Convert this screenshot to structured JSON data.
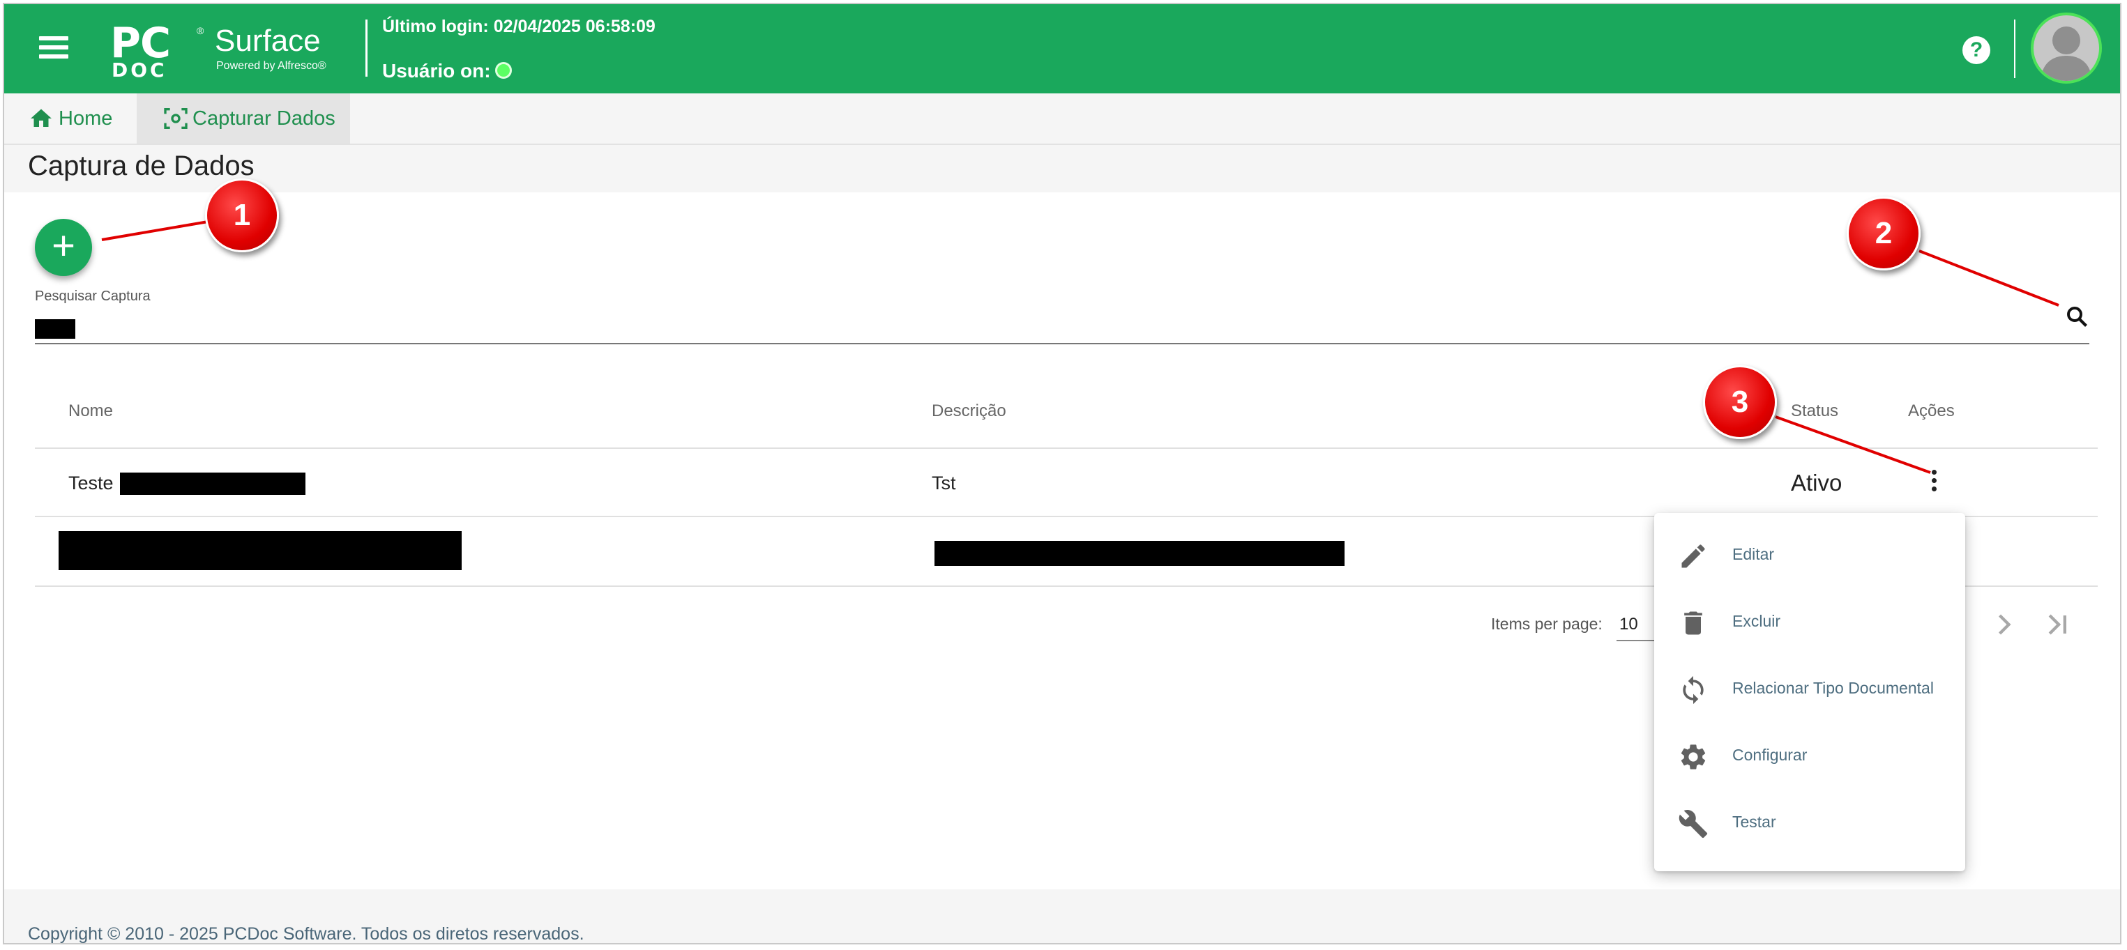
{
  "header": {
    "menu_icon": "hamburger-icon",
    "logo_main": "PC",
    "logo_sub": "DOC",
    "logo_registered": "®",
    "product_name": "Surface",
    "powered_by": "Powered by Alfresco®",
    "last_login": "Último login: 02/04/2025 06:58:09",
    "user_status_label": "Usuário on:",
    "help_icon": "question-circle-icon",
    "help_glyph": "?",
    "avatar_icon": "user-avatar-icon",
    "accent_color": "#1aa85c"
  },
  "tabs": [
    {
      "label": "Home",
      "icon": "home-icon"
    },
    {
      "label": "Capturar Dados",
      "icon": "capture-icon"
    }
  ],
  "page": {
    "title": "Captura de Dados",
    "add_button_glyph": "+",
    "search_label": "Pesquisar Captura",
    "search_value": ""
  },
  "table": {
    "columns": [
      "Nome",
      "Descrição",
      "Status",
      "Ações"
    ],
    "rows": [
      {
        "nome": "Teste",
        "descricao": "Tst",
        "status": "Ativo"
      },
      {
        "nome": "",
        "descricao": "",
        "status": ""
      }
    ]
  },
  "paginator": {
    "items_per_page_label": "Items per page:",
    "items_per_page_value": "10"
  },
  "actions_menu": [
    {
      "label": "Editar",
      "icon": "pencil-icon"
    },
    {
      "label": "Excluir",
      "icon": "trash-icon"
    },
    {
      "label": "Relacionar Tipo Documental",
      "icon": "sync-icon"
    },
    {
      "label": "Configurar",
      "icon": "gear-icon"
    },
    {
      "label": "Testar",
      "icon": "wrench-icon"
    }
  ],
  "callouts": [
    "1",
    "2",
    "3"
  ],
  "footer": {
    "copyright": "Copyright © 2010 - 2025 PCDoc Software. Todos os diretos reservados."
  }
}
